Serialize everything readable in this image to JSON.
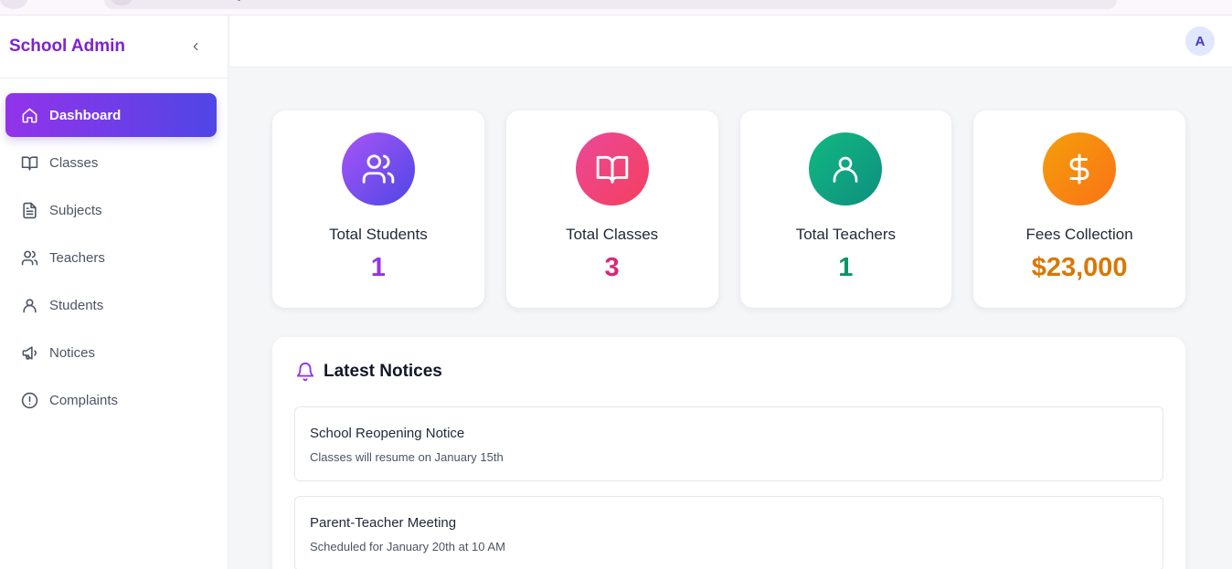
{
  "app": {
    "brand": "School Admin"
  },
  "sidebar": {
    "items": [
      {
        "label": "Dashboard",
        "icon": "home-icon",
        "active": true
      },
      {
        "label": "Classes",
        "icon": "book-open-icon"
      },
      {
        "label": "Subjects",
        "icon": "file-text-icon"
      },
      {
        "label": "Teachers",
        "icon": "users-icon"
      },
      {
        "label": "Students",
        "icon": "user-icon"
      },
      {
        "label": "Notices",
        "icon": "megaphone-icon"
      },
      {
        "label": "Complaints",
        "icon": "alert-circle-icon"
      }
    ]
  },
  "topbar": {
    "avatar_initial": "A"
  },
  "stats": [
    {
      "label": "Total Students",
      "value": "1",
      "icon": "users-icon",
      "color": "#9333ea"
    },
    {
      "label": "Total Classes",
      "value": "3",
      "icon": "book-open-icon",
      "color": "#db2777"
    },
    {
      "label": "Total Teachers",
      "value": "1",
      "icon": "user-icon",
      "color": "#059669"
    },
    {
      "label": "Fees Collection",
      "value": "$23,000",
      "icon": "dollar-icon",
      "color": "#d97706"
    }
  ],
  "notices": {
    "title": "Latest Notices",
    "items": [
      {
        "title": "School Reopening Notice",
        "description": "Classes will resume on January 15th"
      },
      {
        "title": "Parent-Teacher Meeting",
        "description": "Scheduled for January 20th at 10 AM"
      }
    ]
  }
}
